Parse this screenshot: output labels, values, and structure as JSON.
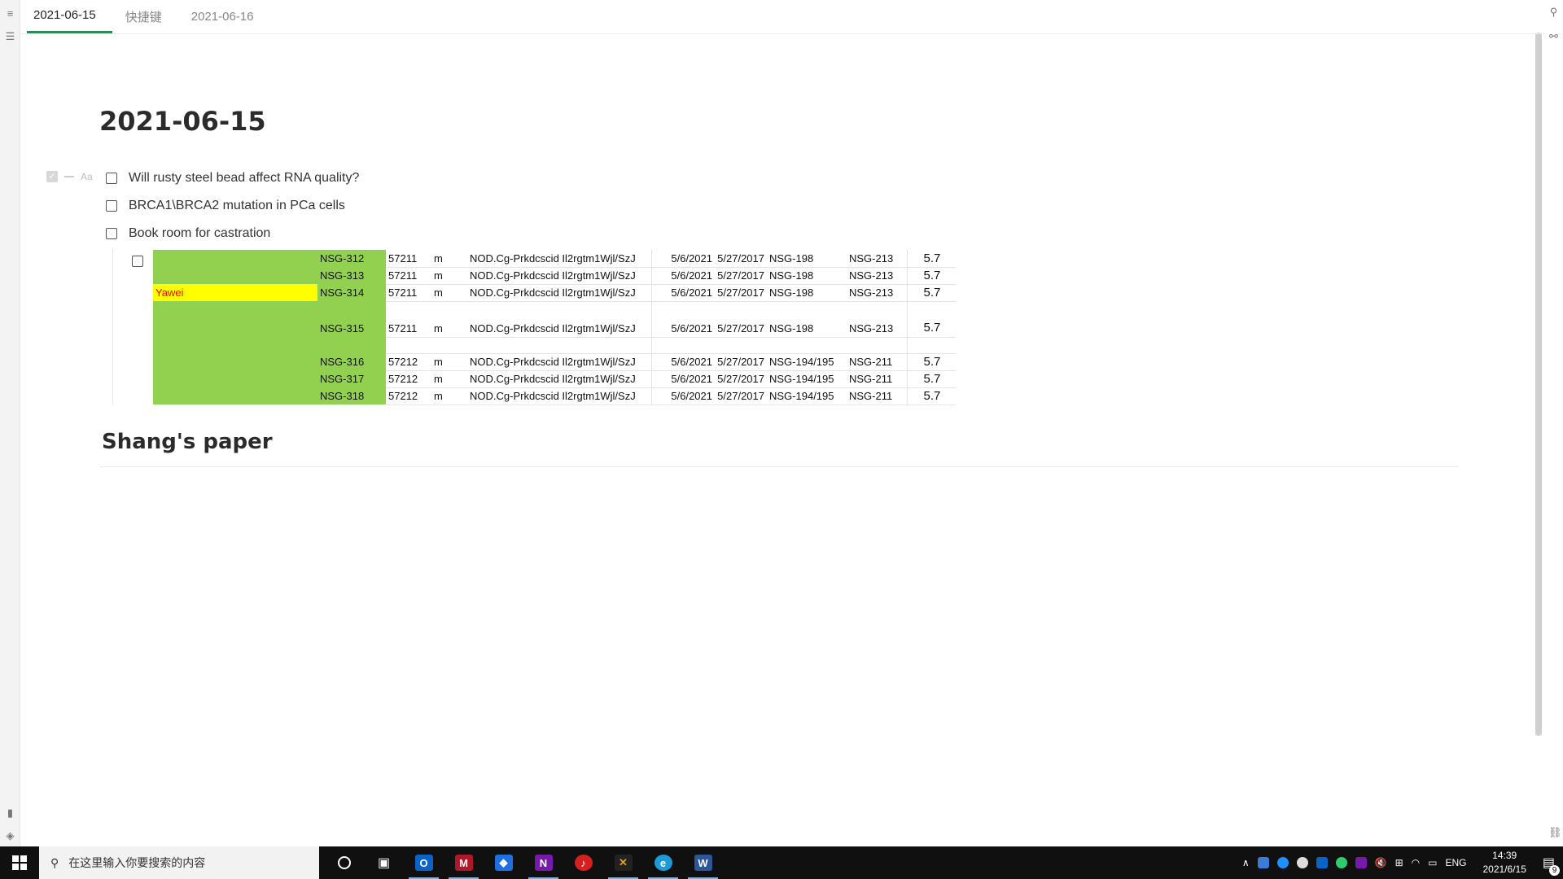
{
  "tabs": [
    {
      "label": "2021-06-15",
      "active": true
    },
    {
      "label": "快捷键",
      "active": false
    },
    {
      "label": "2021-06-16",
      "active": false
    }
  ],
  "doc": {
    "title": "2021-06-15",
    "block_tool_aa": "Aa",
    "todos": [
      "Will rusty steel bead affect RNA quality?",
      "BRCA1\\BRCA2 mutation in PCa cells",
      "Book room for castration"
    ],
    "table_rows": [
      {
        "a": "",
        "b": "NSG-312",
        "c": "57211",
        "d": "m",
        "e": "NOD.Cg-Prkdcscid Il2rgtm1Wjl/SzJ",
        "f": "5/6/2021",
        "g": "5/27/2017",
        "h": "NSG-198",
        "i": "NSG-213",
        "j": "5.7"
      },
      {
        "a": "",
        "b": "NSG-313",
        "c": "57211",
        "d": "m",
        "e": "NOD.Cg-Prkdcscid Il2rgtm1Wjl/SzJ",
        "f": "5/6/2021",
        "g": "5/27/2017",
        "h": "NSG-198",
        "i": "NSG-213",
        "j": "5.7"
      },
      {
        "a": "Yawei",
        "b": "NSG-314",
        "c": "57211",
        "d": "m",
        "e": "NOD.Cg-Prkdcscid Il2rgtm1Wjl/SzJ",
        "f": "5/6/2021",
        "g": "5/27/2017",
        "h": "NSG-198",
        "i": "NSG-213",
        "j": "5.7"
      },
      {
        "a": "",
        "b": "NSG-315",
        "c": "57211",
        "d": "m",
        "e": "NOD.Cg-Prkdcscid Il2rgtm1Wjl/SzJ",
        "f": "5/6/2021",
        "g": "5/27/2017",
        "h": "NSG-198",
        "i": "NSG-213",
        "j": "5.7"
      },
      {
        "a": "",
        "b": "NSG-316",
        "c": "57212",
        "d": "m",
        "e": "NOD.Cg-Prkdcscid Il2rgtm1Wjl/SzJ",
        "f": "5/6/2021",
        "g": "5/27/2017",
        "h": "NSG-194/195",
        "i": "NSG-211",
        "j": "5.7"
      },
      {
        "a": "",
        "b": "NSG-317",
        "c": "57212",
        "d": "m",
        "e": "NOD.Cg-Prkdcscid Il2rgtm1Wjl/SzJ",
        "f": "5/6/2021",
        "g": "5/27/2017",
        "h": "NSG-194/195",
        "i": "NSG-211",
        "j": "5.7"
      },
      {
        "a": "",
        "b": "NSG-318",
        "c": "57212",
        "d": "m",
        "e": "NOD.Cg-Prkdcscid Il2rgtm1Wjl/SzJ",
        "f": "5/6/2021",
        "g": "5/27/2017",
        "h": "NSG-194/195",
        "i": "NSG-211",
        "j": "5.7"
      }
    ],
    "section_heading": "Shang's paper"
  },
  "taskbar": {
    "search_placeholder": "在这里输入你要搜索的内容",
    "apps": [
      {
        "name": "outlook",
        "glyph": "O",
        "color": "#0a64c8",
        "running": true
      },
      {
        "name": "mendeley",
        "glyph": "M",
        "color": "#b0182a",
        "running": true
      },
      {
        "name": "flow",
        "glyph": "◆",
        "color": "#1f6fe0",
        "running": false
      },
      {
        "name": "onenote",
        "glyph": "N",
        "color": "#7719aa",
        "running": true
      },
      {
        "name": "music",
        "glyph": "♪",
        "color": "#d62020",
        "running": false
      },
      {
        "name": "tools",
        "glyph": "✕",
        "color": "#e0a020",
        "running": true
      },
      {
        "name": "edge",
        "glyph": "e",
        "color": "#1c9bd6",
        "running": true
      },
      {
        "name": "word",
        "glyph": "W",
        "color": "#2b579a",
        "running": true
      }
    ],
    "tray_lang": "ENG",
    "time": "14:39",
    "date": "2021/6/15",
    "notification_count": "9"
  },
  "colors": {
    "accent_tab": "#2e8b57",
    "cell_green": "#92d050",
    "cell_yellow": "#ffff00",
    "cell_red_text": "#ff0000"
  }
}
